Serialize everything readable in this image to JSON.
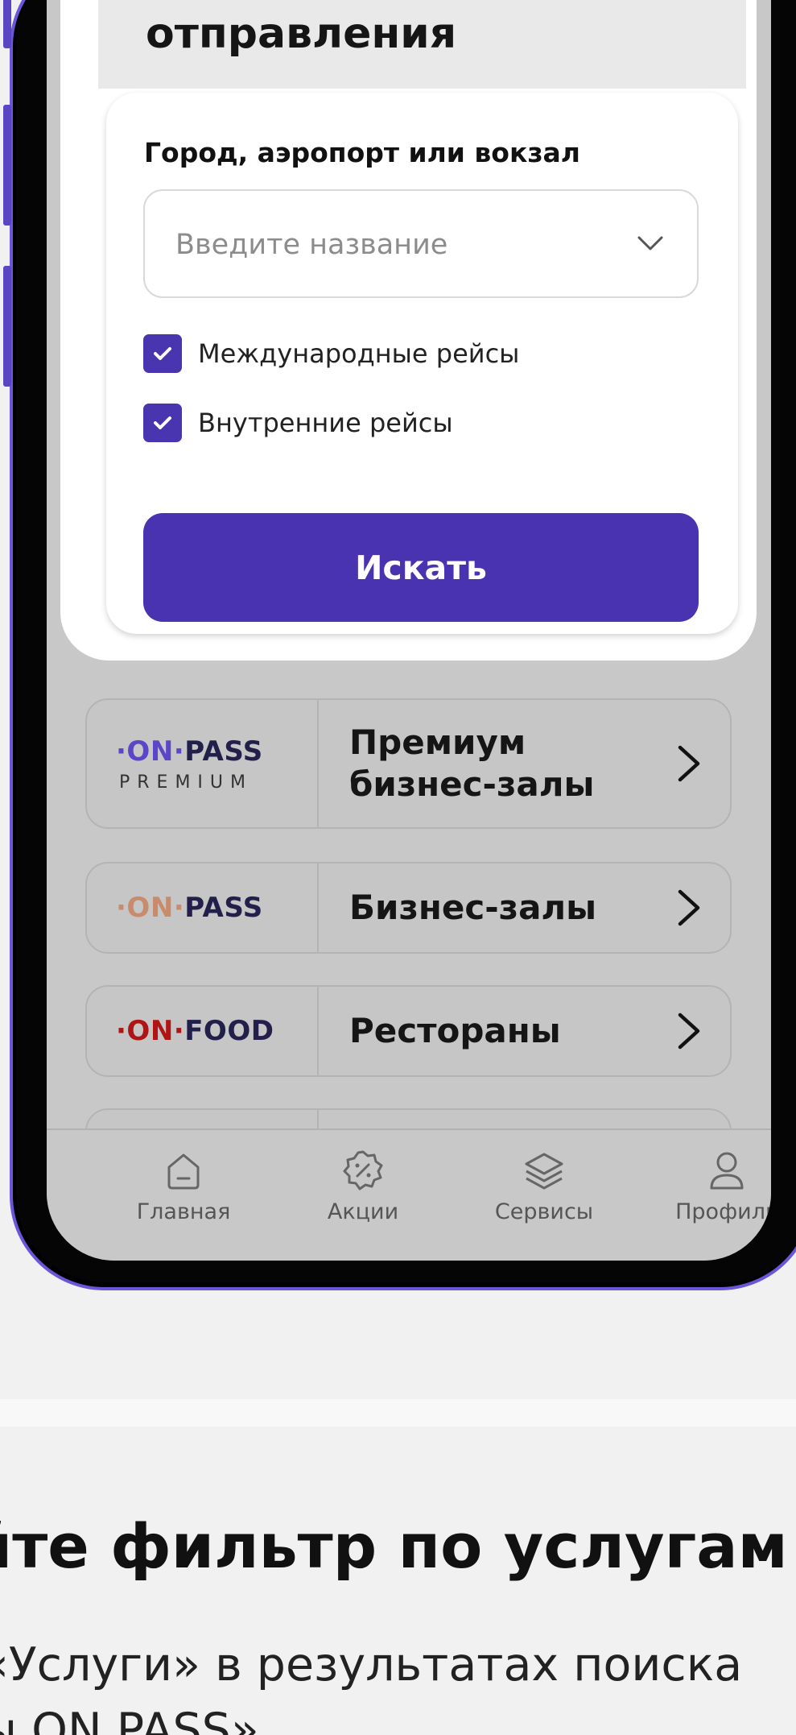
{
  "search": {
    "title": "отправления",
    "field_label": "Город, аэропорт или вокзал",
    "placeholder": "Введите название",
    "checkbox_international": "Международные рейсы",
    "checkbox_domestic": "Внутренние рейсы",
    "international_checked": true,
    "domestic_checked": true,
    "button_label": "Искать"
  },
  "services": [
    {
      "logo_dot1": "·",
      "logo_on": "ON",
      "logo_dot2": "·",
      "logo_brand": "PASS",
      "logo_sub": "PREMIUM",
      "name": "Премиум\nбизнес-залы",
      "on_color": "#5b46c8"
    },
    {
      "logo_dot1": "·",
      "logo_on": "ON",
      "logo_dot2": "·",
      "logo_brand": "PASS",
      "name": "Бизнес-залы",
      "on_color": "#c88c6c"
    },
    {
      "logo_dot1": "·",
      "logo_on": "ON",
      "logo_dot2": "·",
      "logo_brand": "FOOD",
      "name": "Рестораны",
      "on_color": "#b01515"
    }
  ],
  "tabbar": {
    "items": [
      {
        "label": "Главная",
        "icon": "home-icon"
      },
      {
        "label": "Акции",
        "icon": "discount-badge-icon"
      },
      {
        "label": "Сервисы",
        "icon": "layers-icon"
      },
      {
        "label": "Профиль",
        "icon": "user-icon"
      }
    ]
  },
  "promo": {
    "title": "йте фильтр по услугам",
    "line1": "«Услуги» в результатах поиска",
    "line2": "ы ON PASS»"
  },
  "colors": {
    "accent": "#4a33b1",
    "phone_frame": "#6b55d8"
  }
}
